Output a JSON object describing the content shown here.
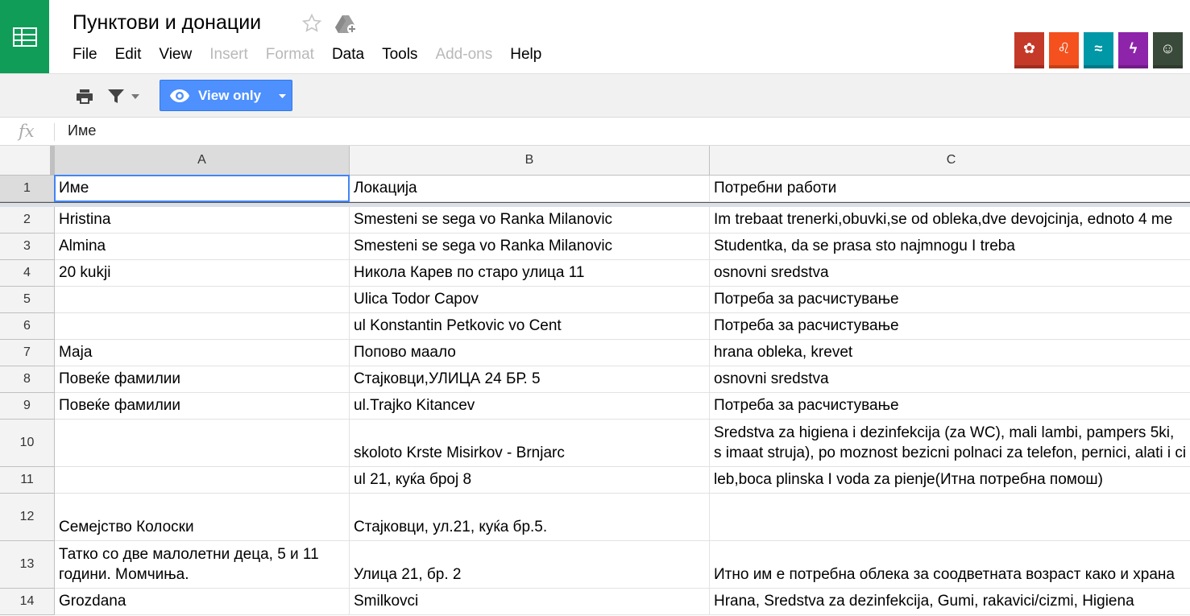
{
  "app": {
    "title": "Пунктови и донации",
    "icon": "sheets-grid-icon",
    "accent_color": "#0f9d58"
  },
  "menu": [
    {
      "label": "File",
      "disabled": false
    },
    {
      "label": "Edit",
      "disabled": false
    },
    {
      "label": "View",
      "disabled": false
    },
    {
      "label": "Insert",
      "disabled": true
    },
    {
      "label": "Format",
      "disabled": true
    },
    {
      "label": "Data",
      "disabled": false
    },
    {
      "label": "Tools",
      "disabled": false
    },
    {
      "label": "Add-ons",
      "disabled": true
    },
    {
      "label": "Help",
      "disabled": false
    }
  ],
  "avatars": [
    {
      "name": "anonymous-fox-avatar",
      "color": "#c53929",
      "glyph": "✿"
    },
    {
      "name": "anonymous-lion-avatar",
      "color": "#f4511e",
      "glyph": "♌"
    },
    {
      "name": "anonymous-manatee-avatar",
      "color": "#0097a7",
      "glyph": "≈"
    },
    {
      "name": "anonymous-squirrel-avatar",
      "color": "#8e24aa",
      "glyph": "ϟ"
    },
    {
      "name": "user-photo-avatar",
      "color": "#3a4a3a",
      "glyph": "☺"
    }
  ],
  "toolbar": {
    "view_only_label": "View only"
  },
  "formula_bar": {
    "fx_label": "fx",
    "value": "Име"
  },
  "columns": [
    "A",
    "B",
    "C"
  ],
  "rows": [
    {
      "num": "1",
      "cells": [
        "Име",
        "Локација",
        "Потребни работи"
      ]
    },
    {
      "num": "2",
      "cells": [
        "Hristina",
        "Smesteni se sega vo Ranka Milanovic",
        "Im trebaat trenerki,obuvki,se od obleka,dve devojcinja, ednoto 4 me"
      ]
    },
    {
      "num": "3",
      "cells": [
        "Almina",
        "Smesteni se sega vo Ranka Milanovic",
        "Studentka, da se prasa sto najmnogu I treba"
      ]
    },
    {
      "num": "4",
      "cells": [
        "20 kukji",
        "Никола Карев по старо улица 11",
        "osnovni sredstva"
      ]
    },
    {
      "num": "5",
      "cells": [
        "",
        "Ulica Todor Capov",
        "Потреба за расчистување"
      ]
    },
    {
      "num": "6",
      "cells": [
        "",
        "ul Konstantin Petkovic vo Cent",
        "Потреба за расчистување"
      ]
    },
    {
      "num": "7",
      "cells": [
        "Маја",
        "Попово маало",
        "hrana obleka, krevet"
      ]
    },
    {
      "num": "8",
      "cells": [
        "Повеќе фамилии",
        "Стајковци,УЛИЦА 24 БР. 5",
        "osnovni sredstva"
      ]
    },
    {
      "num": "9",
      "cells": [
        "Повеќе фамилии",
        "ul.Trajko Kitancev",
        "Потреба за расчистување"
      ]
    },
    {
      "num": "10",
      "cells": [
        "",
        "skoloto Krste Misirkov - Brnjarc",
        "Sredstva za higiena i dezinfekcija (za WC), mali lambi, pampers 5ki, s imaat struja), po moznost bezicni polnaci za telefon, pernici, alati i ci"
      ]
    },
    {
      "num": "11",
      "cells": [
        "",
        "ul 21, куќа број 8",
        "leb,boca plinska I voda za pienje(Итна потребна помош)"
      ]
    },
    {
      "num": "12",
      "cells": [
        "Семејство Колоски",
        "Стајковци, ул.21, куќа бр.5.",
        ""
      ]
    },
    {
      "num": "13",
      "cells": [
        "Татко со две малолетни деца, 5 и 11 години. Момчиња.",
        "Улица 21, бр. 2",
        "Итно им е потребна облека за соодветната возраст како и храна"
      ]
    },
    {
      "num": "14",
      "cells": [
        "Grozdana",
        "Smilkovci",
        "Hrana, Sredstva za dezinfekcija, Gumi, rakavici/cizmi, Higiena"
      ]
    }
  ]
}
